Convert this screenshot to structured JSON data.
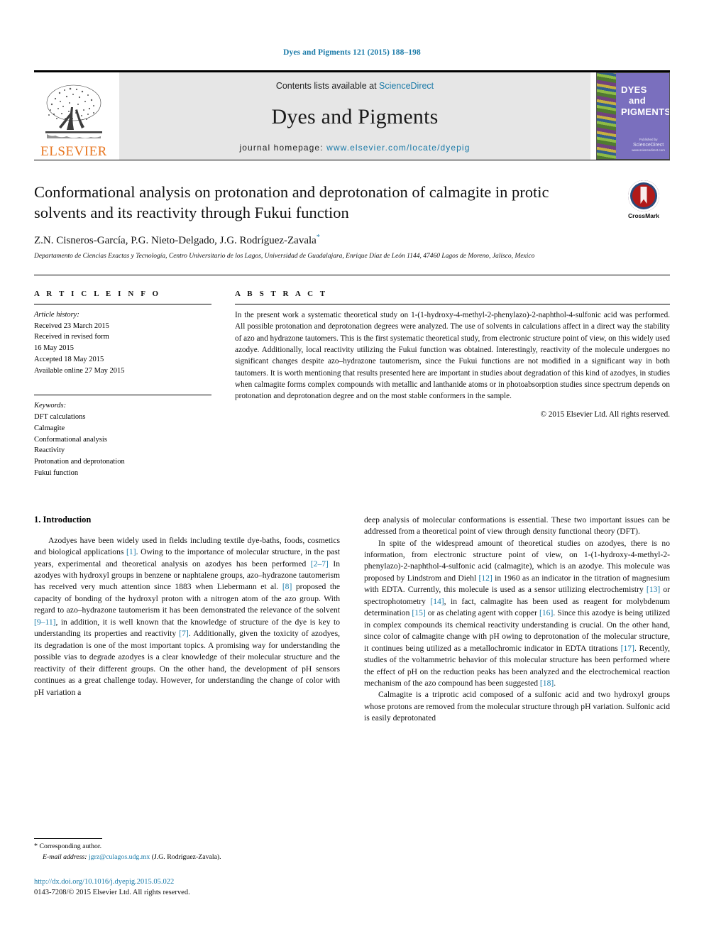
{
  "running_head": "Dyes and Pigments 121 (2015) 188–198",
  "masthead": {
    "publisher_name": "ELSEVIER",
    "contents_prefix": "Contents lists available at ",
    "contents_link": "ScienceDirect",
    "journal_title": "Dyes and Pigments",
    "homepage_prefix": "journal homepage: ",
    "homepage_link": "www.elsevier.com/locate/dyepig",
    "cover": {
      "line1": "DYES",
      "line2": "and",
      "line3": "PIGMENTS",
      "publisher_small": "Published by",
      "publisher_name": "ScienceDirect",
      "publisher_tag": "www.sciencedirect.com"
    }
  },
  "article": {
    "title": "Conformational analysis on protonation and deprotonation of calmagite in protic solvents and its reactivity through Fukui function",
    "authors": "Z.N. Cisneros-García, P.G. Nieto-Delgado, J.G. Rodríguez-Zavala",
    "corresponding_marker": "*",
    "affiliation": "Departamento de Ciencias Exactas y Tecnología, Centro Universitario de los Lagos, Universidad de Guadalajara, Enrique Díaz de León 1144, 47460 Lagos de Moreno, Jalisco, Mexico",
    "crossmark_label": "CrossMark"
  },
  "article_info": {
    "heading": "A R T I C L E  I N F O",
    "history_label": "Article history:",
    "history": [
      "Received 23 March 2015",
      "Received in revised form",
      "16 May 2015",
      "Accepted 18 May 2015",
      "Available online 27 May 2015"
    ],
    "keywords_label": "Keywords:",
    "keywords": [
      "DFT calculations",
      "Calmagite",
      "Conformational analysis",
      "Reactivity",
      "Protonation and deprotonation",
      "Fukui function"
    ]
  },
  "abstract": {
    "heading": "A B S T R A C T",
    "text": "In the present work a systematic theoretical study on 1-(1-hydroxy-4-methyl-2-phenylazo)-2-naphthol-4-sulfonic acid was performed. All possible protonation and deprotonation degrees were analyzed. The use of solvents in calculations affect in a direct way the stability of azo and hydrazone tautomers. This is the first systematic theoretical study, from electronic structure point of view, on this widely used azodye. Additionally, local reactivity utilizing the Fukui function was obtained. Interestingly, reactivity of the molecule undergoes no significant changes despite azo–hydrazone tautomerism, since the Fukui functions are not modified in a significant way in both tautomers. It is worth mentioning that results presented here are important in studies about degradation of this kind of azodyes, in studies when calmagite forms complex compounds with metallic and lanthanide atoms or in photoabsorption studies since spectrum depends on protonation and deprotonation degree and on the most stable conformers in the sample.",
    "copyright": "© 2015 Elsevier Ltd. All rights reserved."
  },
  "body": {
    "section_title": "1.  Introduction",
    "left_paragraph_1_a": "Azodyes have been widely used in fields including textile dye-baths, foods, cosmetics and biological applications ",
    "left_ref_1": "[1]",
    "left_paragraph_1_b": ". Owing to the importance of molecular structure, in the past years, experimental and theoretical analysis on azodyes has been performed ",
    "left_ref_2": "[2–7]",
    "left_paragraph_1_c": " In azodyes with hydroxyl groups in benzene or naphtalene groups, azo–hydrazone tautomerism has received very much attention since 1883 when Liebermann et al. ",
    "left_ref_3": "[8]",
    "left_paragraph_1_d": " proposed the capacity of bonding of the hydroxyl proton with a nitrogen atom of the azo group. With regard to azo–hydrazone tautomerism it has been demonstrated the relevance of the solvent ",
    "left_ref_4": "[9–11]",
    "left_paragraph_1_e": ", in addition, it is well known that the knowledge of structure of the dye is key to understanding its properties and reactivity ",
    "left_ref_5": "[7]",
    "left_paragraph_1_f": ". Additionally, given the toxicity of azodyes, its degradation is one of the most important topics. A promising way for understanding the possible vias to degrade azodyes is a clear knowledge of their molecular structure and the reactivity of their different groups. On the other hand, the development of pH sensors continues as a great challenge today. However, for understanding the change of color with pH variation a",
    "right_paragraph_1": "deep analysis of molecular conformations is essential. These two important issues can be addressed from a theoretical point of view through density functional theory (DFT).",
    "right_paragraph_2_a": "In spite of the widespread amount of theoretical studies on azodyes, there is no information, from electronic structure point of view, on 1-(1-hydroxy-4-methyl-2-phenylazo)-2-naphthol-4-sulfonic acid (calmagite), which is an azodye. This molecule was proposed by Lindstrom and Diehl ",
    "right_ref_12": "[12]",
    "right_paragraph_2_b": " in 1960 as an indicator in the titration of magnesium with EDTA. Currently, this molecule is used as a sensor utilizing electrochemistry ",
    "right_ref_13": "[13]",
    "right_paragraph_2_c": " or spectrophotometry ",
    "right_ref_14": "[14]",
    "right_paragraph_2_d": ", in fact, calmagite has been used as reagent for molybdenum determination ",
    "right_ref_15": "[15]",
    "right_paragraph_2_e": " or as chelating agent with copper ",
    "right_ref_16": "[16]",
    "right_paragraph_2_f": ". Since this azodye is being utilized in complex compounds its chemical reactivity understanding is crucial. On the other hand, since color of calmagite change with pH owing to deprotonation of the molecular structure, it continues being utilized as a metallochromic indicator in EDTA titrations ",
    "right_ref_17": "[17]",
    "right_paragraph_2_g": ". Recently, studies of the voltammetric behavior of this molecular structure has been performed where the effect of pH on the reduction peaks has been analyzed and the electrochemical reaction mechanism of the azo compound has been suggested ",
    "right_ref_18": "[18]",
    "right_paragraph_2_h": ".",
    "right_paragraph_3": "Calmagite is a triprotic acid composed of a sulfonic acid and two hydroxyl groups whose protons are removed from the molecular structure through pH variation. Sulfonic acid is easily deprotonated"
  },
  "footnotes": {
    "corresponding_star": "*",
    "corresponding_text": "Corresponding author.",
    "email_label": "E-mail address:",
    "email": "jgrz@culagos.udg.mx",
    "email_owner": "(J.G. Rodríguez-Zavala).",
    "doi": "http://dx.doi.org/10.1016/j.dyepig.2015.05.022",
    "issn_line": "0143-7208/© 2015 Elsevier Ltd. All rights reserved."
  },
  "colors": {
    "link": "#1a7aa8",
    "elsevier_orange": "#E87722",
    "cover_purple": "#7a6fbe",
    "crossmark_red": "#b01a1a"
  }
}
